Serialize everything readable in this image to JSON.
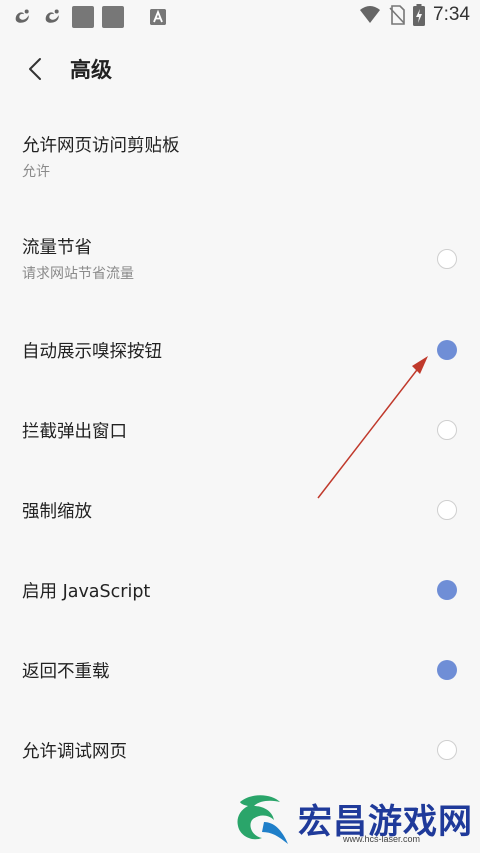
{
  "status_bar": {
    "time": "7:34",
    "left_icons": [
      "uc-browser-icon",
      "uc-browser-icon",
      "gray-square-icon",
      "gray-square-icon",
      "font-a-icon"
    ],
    "right_icons": [
      "wifi-icon",
      "no-sim-icon",
      "battery-charging-icon"
    ]
  },
  "header": {
    "back_icon": "chevron-left-icon",
    "title": "高级"
  },
  "settings": [
    {
      "title": "允许网页访问剪贴板",
      "subtitle": "允许"
    },
    {
      "title": "流量节省",
      "subtitle": "请求网站节省流量",
      "checked": false
    },
    {
      "title": "自动展示嗅探按钮",
      "checked": true
    },
    {
      "title": "拦截弹出窗口",
      "checked": false
    },
    {
      "title": "强制缩放",
      "checked": false
    },
    {
      "title": "启用 JavaScript",
      "checked": true
    },
    {
      "title": "返回不重载",
      "checked": true
    },
    {
      "title": "允许调试网页",
      "checked": false
    }
  ],
  "colors": {
    "accent": "#6f8ed6",
    "background": "#f7f7f7",
    "annotation_arrow": "#c0392b",
    "watermark": "#1f3a9a"
  },
  "watermark": {
    "text": "宏昌游戏网",
    "url": "www.hcs-laser.com"
  }
}
